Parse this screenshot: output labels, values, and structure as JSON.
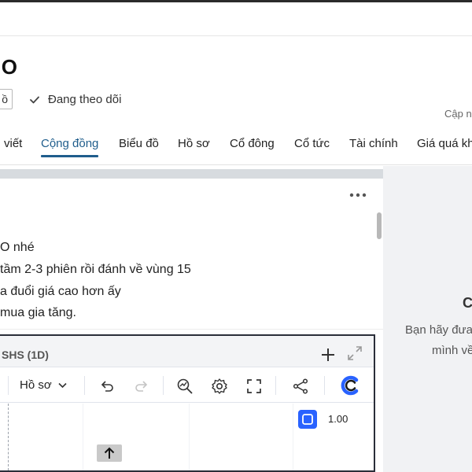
{
  "header": {
    "ticker_fragment": ".O",
    "small_box_text": "ồ",
    "follow_label": "Đang theo dõi",
    "update_label": "Cập n"
  },
  "tabs": [
    {
      "label": "viết",
      "active": false
    },
    {
      "label": "Cộng đồng",
      "active": true
    },
    {
      "label": "Biểu đồ",
      "active": false
    },
    {
      "label": "Hồ sơ",
      "active": false
    },
    {
      "label": "Cổ đông",
      "active": false
    },
    {
      "label": "Cổ tức",
      "active": false
    },
    {
      "label": "Tài chính",
      "active": false
    },
    {
      "label": "Giá quá kh",
      "active": false
    }
  ],
  "post": {
    "lines": [
      "O nhé",
      " tầm 2-3 phiên rồi đánh về vùng 15",
      "a đuổi giá cao hơn ấy",
      "mua gia tăng."
    ]
  },
  "chart_widget": {
    "title": "SHS (1D)",
    "profile_label": "Hồ sơ",
    "scale_value": "1.00",
    "accent_color": "#2962ff",
    "icons": [
      "plus-icon",
      "expand-icon",
      "undo-icon",
      "redo-icon",
      "zoom-icon",
      "gear-icon",
      "fullscreen-icon",
      "share-icon",
      "logo-icon",
      "arrow-up-icon"
    ]
  },
  "side_panel": {
    "title": "C",
    "line1": "Bạn hãy đưa",
    "line2": "mình về"
  },
  "colors": {
    "active_tab": "#1f5d8c",
    "side_bg": "#f1f2f4"
  }
}
